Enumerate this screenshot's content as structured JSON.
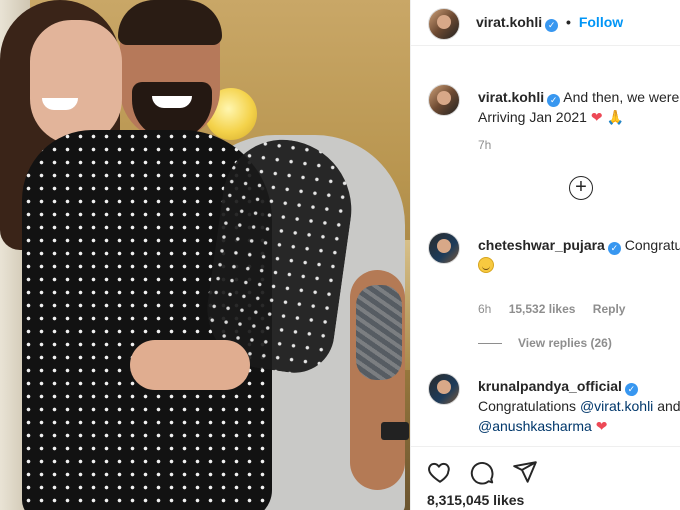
{
  "post": {
    "username": "virat.kohli",
    "follow_label": "Follow",
    "header_dot": "•"
  },
  "caption": {
    "username": "virat.kohli",
    "text_line1": "And then, we were",
    "text_line2": "Arriving Jan 2021",
    "emoji_heart": "❤",
    "emoji_pray": "🙏",
    "time": "7h"
  },
  "load_more_symbol": "+",
  "comments": [
    {
      "username": "cheteshwar_pujara",
      "text": "Congratulations to both of you",
      "time": "6h",
      "likes": "15,532 likes",
      "reply": "Reply",
      "view_replies": "View replies (26)"
    },
    {
      "username": "krunalpandya_official",
      "text_prefix": "Congratulations",
      "mention1": "@virat.kohli",
      "text_and": "and",
      "mention2": "@anushkasharma",
      "emoji_heart": "❤"
    }
  ],
  "footer": {
    "likes": "8,315,045 likes"
  },
  "icons": [
    "heart-icon",
    "comment-icon",
    "share-icon",
    "verified-icon",
    "add-icon"
  ],
  "colors": {
    "accent": "#0095f6",
    "verified": "#3897f0",
    "heart": "#ed4956",
    "muted": "#8e8e8e"
  }
}
